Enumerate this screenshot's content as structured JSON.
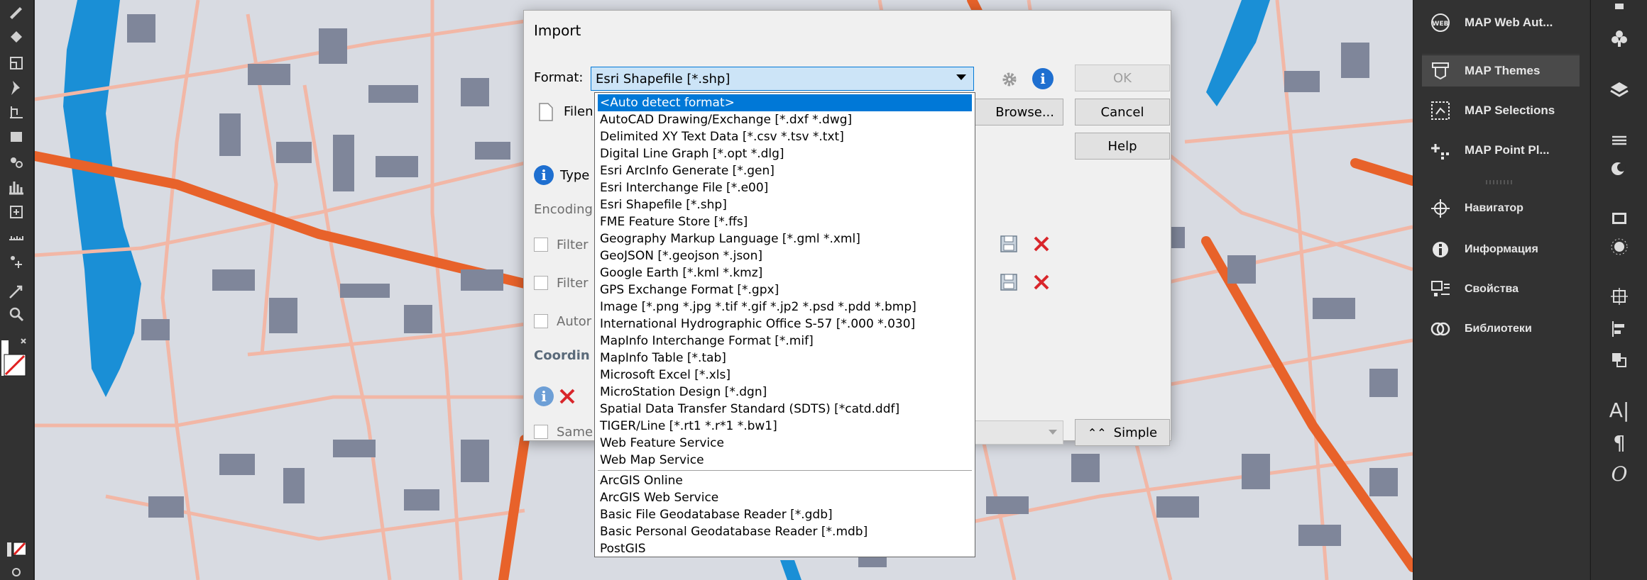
{
  "dialog": {
    "title": "Import",
    "format_label": "Format:",
    "format_value": "Esri Shapefile [*.shp]",
    "filename_label": "Filen",
    "browse_label": "Browse...",
    "type_label": "Type",
    "encoding_label": "Encoding",
    "filter1_label": "Filter",
    "filter2_label": "Filter",
    "auto_label": "Autor",
    "coordinates_label": "Coordin",
    "same_label": "Same",
    "ok_label": "OK",
    "cancel_label": "Cancel",
    "help_label": "Help",
    "simple_label": "Simple"
  },
  "format_options": [
    "<Auto detect format>",
    "AutoCAD Drawing/Exchange [*.dxf *.dwg]",
    "Delimited XY Text Data [*.csv *.tsv *.txt]",
    "Digital Line Graph [*.opt *.dlg]",
    "Esri ArcInfo Generate [*.gen]",
    "Esri Interchange File [*.e00]",
    "Esri Shapefile [*.shp]",
    "FME Feature Store [*.ffs]",
    "Geography Markup Language [*.gml *.xml]",
    "GeoJSON [*.geojson *.json]",
    "Google Earth [*.kml *.kmz]",
    "GPS Exchange Format [*.gpx]",
    "Image [*.png *.jpg *.tif *.gif *.jp2 *.psd *.pdd *.bmp]",
    "International Hydrographic Office S-57 [*.000 *.030]",
    "MapInfo Interchange Format [*.mif]",
    "MapInfo Table [*.tab]",
    "Microsoft Excel [*.xls]",
    "MicroStation Design [*.dgn]",
    "Spatial Data Transfer Standard (SDTS) [*catd.ddf]",
    "TIGER/Line [*.rt1 *.r*1 *.bw1]",
    "Web Feature Service",
    "Web Map Service",
    "ArcGIS Online",
    "ArcGIS Web Service",
    "Basic File Geodatabase Reader [*.gdb]",
    "Basic Personal Geodatabase Reader [*.mdb]",
    "PostGIS"
  ],
  "selected_option_index": 0,
  "panels": [
    {
      "label": "MAP Web Aut...",
      "icon": "web-icon"
    },
    {
      "label": "MAP Themes",
      "icon": "themes-icon"
    },
    {
      "label": "MAP Selections",
      "icon": "selections-icon"
    },
    {
      "label": "MAP Point Pl...",
      "icon": "point-placement-icon"
    },
    {
      "label": "Навигатор",
      "icon": "navigator-icon"
    },
    {
      "label": "Информация",
      "icon": "info-icon"
    },
    {
      "label": "Свойства",
      "icon": "properties-icon"
    },
    {
      "label": "Библиотеки",
      "icon": "libraries-icon"
    }
  ],
  "right_icon_glyphs": {
    "character": "A|",
    "paragraph": "¶",
    "opentype": "O"
  },
  "colors": {
    "accent": "#0078d7",
    "map_background": "#d8dbe2",
    "road_major": "#e8622a",
    "road_minor": "#f2b7a6",
    "water": "#1a8fd6",
    "building": "#7f869a",
    "panel_bg": "#323232"
  }
}
